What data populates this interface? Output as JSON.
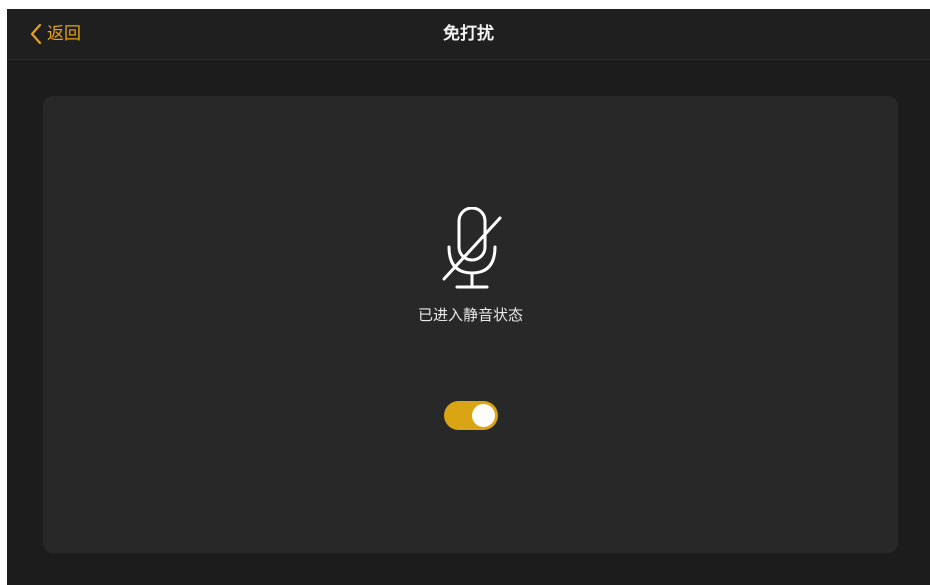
{
  "header": {
    "back_label": "返回",
    "title": "免打扰"
  },
  "main": {
    "status_text": "已进入静音状态",
    "mute_toggle": {
      "on": true
    }
  },
  "icons": {
    "back": "chevron-left-icon",
    "status": "mic-off-icon"
  },
  "colors": {
    "accent": "#e7a21a",
    "toggle_on": "#d9a514",
    "background": "#1c1c1c",
    "panel": "#282828"
  }
}
